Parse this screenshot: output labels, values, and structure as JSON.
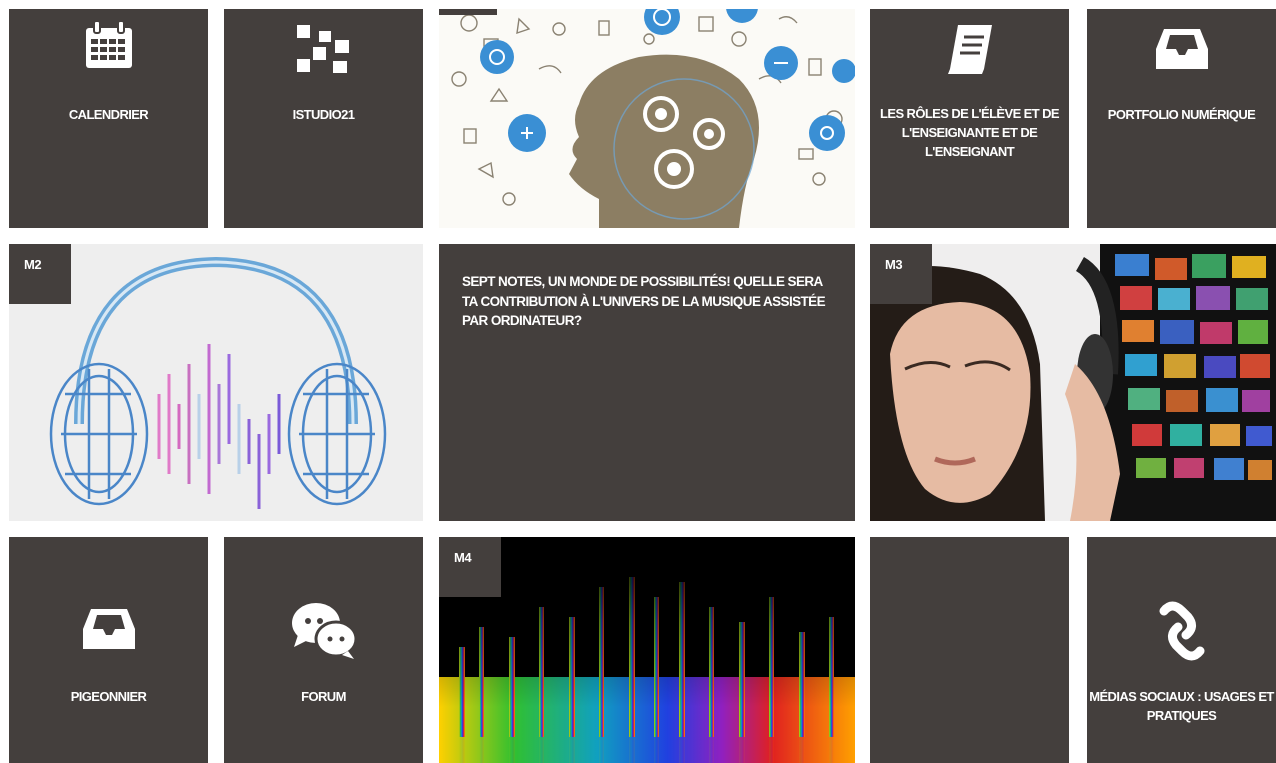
{
  "tiles": {
    "calendrier": {
      "label": "CALENDRIER",
      "icon": "calendar-icon"
    },
    "istudio": {
      "label": "ISTUDIO21",
      "icon": "istudio-logo-icon"
    },
    "roles": {
      "label": "LES RÔLES DE L'ÉLÈVE ET DE L'ENSEIGNANTE ET DE L'ENSEIGNANT",
      "icon": "book-icon"
    },
    "portfolio": {
      "label": "PORTFOLIO NUMÉRIQUE",
      "icon": "inbox-tray-icon"
    },
    "m2": {
      "badge": "M2",
      "image": "headphones-soundwave-image"
    },
    "description": {
      "text": "SEPT NOTES, UN MONDE DE POSSIBILITÉS! QUELLE SERA TA CONTRIBUTION À L'UNIVERS DE LA MUSIQUE ASSISTÉE PAR ORDINATEUR?"
    },
    "m3": {
      "badge": "M3",
      "image": "woman-headphones-screens-image"
    },
    "pigeonnier": {
      "label": "PIGEONNIER",
      "icon": "inbox-tray-icon"
    },
    "forum": {
      "label": "FORUM",
      "icon": "chat-bubbles-icon"
    },
    "m4": {
      "badge": "M4",
      "image": "colorful-equalizer-image"
    },
    "medias": {
      "label": "MÉDIAS SOCIAUX : USAGES ET PRATIQUES",
      "icon": "chain-link-icon"
    }
  },
  "colors": {
    "tile_bg": "#443f3d",
    "text": "#ffffff",
    "accent_blue": "#3a8fd4"
  }
}
